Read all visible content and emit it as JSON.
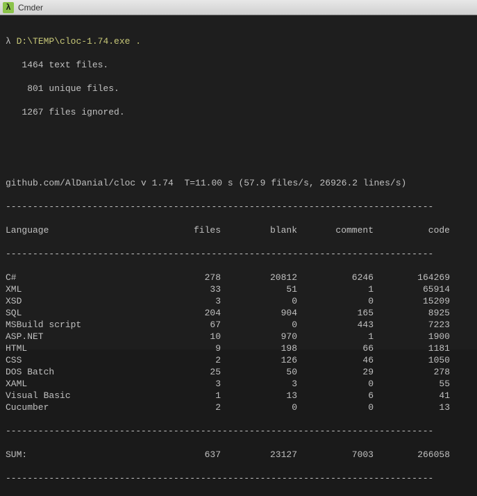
{
  "titlebar": {
    "icon_text": "λ",
    "title": "Cmder"
  },
  "prompt": {
    "lambda": "λ",
    "command": "D:\\TEMP\\cloc-1.74.exe ."
  },
  "file_summary": {
    "text_files": "   1464 text files.",
    "unique_files": "    801 unique files.",
    "ignored_files": "   1267 files ignored."
  },
  "header_line": "github.com/AlDanial/cloc v 1.74  T=11.00 s (57.9 files/s, 26926.2 lines/s)",
  "dashes": "-------------------------------------------------------------------------------",
  "columns": {
    "language": "Language",
    "files": "files",
    "blank": "blank",
    "comment": "comment",
    "code": "code"
  },
  "chart_data": {
    "type": "table",
    "title": "cloc output",
    "columns": [
      "Language",
      "files",
      "blank",
      "comment",
      "code"
    ],
    "rows": [
      {
        "language": "C#",
        "files": 278,
        "blank": 20812,
        "comment": 6246,
        "code": 164269
      },
      {
        "language": "XML",
        "files": 33,
        "blank": 51,
        "comment": 1,
        "code": 65914
      },
      {
        "language": "XSD",
        "files": 3,
        "blank": 0,
        "comment": 0,
        "code": 15209
      },
      {
        "language": "SQL",
        "files": 204,
        "blank": 904,
        "comment": 165,
        "code": 8925
      },
      {
        "language": "MSBuild script",
        "files": 67,
        "blank": 0,
        "comment": 443,
        "code": 7223
      },
      {
        "language": "ASP.NET",
        "files": 10,
        "blank": 970,
        "comment": 1,
        "code": 1900
      },
      {
        "language": "HTML",
        "files": 9,
        "blank": 198,
        "comment": 66,
        "code": 1181
      },
      {
        "language": "CSS",
        "files": 2,
        "blank": 126,
        "comment": 46,
        "code": 1050
      },
      {
        "language": "DOS Batch",
        "files": 25,
        "blank": 50,
        "comment": 29,
        "code": 278
      },
      {
        "language": "XAML",
        "files": 3,
        "blank": 3,
        "comment": 0,
        "code": 55
      },
      {
        "language": "Visual Basic",
        "files": 1,
        "blank": 13,
        "comment": 6,
        "code": 41
      },
      {
        "language": "Cucumber",
        "files": 2,
        "blank": 0,
        "comment": 0,
        "code": 13
      }
    ],
    "sum": {
      "language": "SUM:",
      "files": 637,
      "blank": 23127,
      "comment": 7003,
      "code": 266058
    }
  }
}
